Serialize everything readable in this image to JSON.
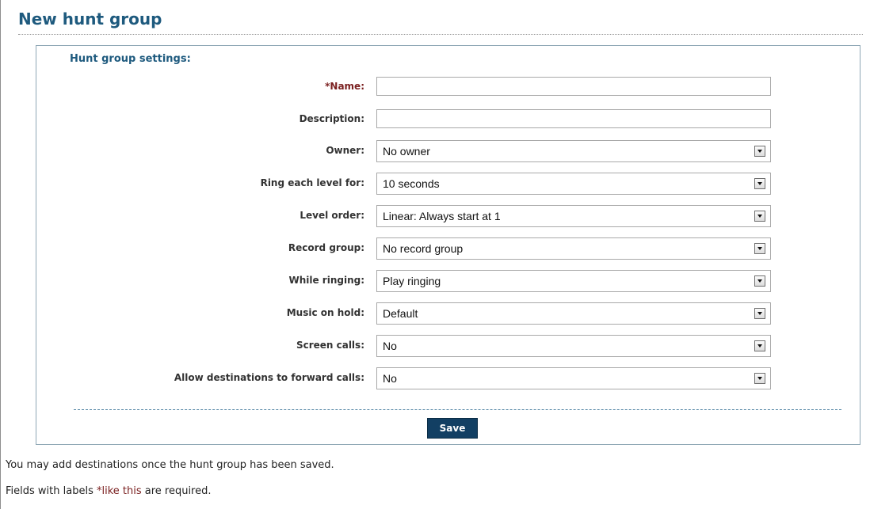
{
  "page": {
    "title": "New hunt group"
  },
  "form": {
    "section_title": "Hunt group settings:",
    "fields": [
      {
        "label": "Name:",
        "required_marker": "*",
        "type": "text",
        "value": ""
      },
      {
        "label": "Description:",
        "type": "text",
        "value": ""
      },
      {
        "label": "Owner:",
        "type": "select",
        "value": "No owner"
      },
      {
        "label": "Ring each level for:",
        "type": "select",
        "value": "10 seconds"
      },
      {
        "label": "Level order:",
        "type": "select",
        "value": "Linear: Always start at 1"
      },
      {
        "label": "Record group:",
        "type": "select",
        "value": "No record group"
      },
      {
        "label": "While ringing:",
        "type": "select",
        "value": "Play ringing"
      },
      {
        "label": "Music on hold:",
        "type": "select",
        "value": "Default"
      },
      {
        "label": "Screen calls:",
        "type": "select",
        "value": "No"
      },
      {
        "label": "Allow destinations to forward calls:",
        "type": "select",
        "value": "No"
      }
    ],
    "save_label": "Save"
  },
  "notes": {
    "destinations": "You may add destinations once the hunt group has been saved.",
    "required_prefix": "Fields with labels ",
    "required_sample": "*like this",
    "required_suffix": " are required."
  },
  "colors": {
    "heading": "#1e5a7e",
    "required": "#7a1f1f",
    "button": "#123f63"
  }
}
